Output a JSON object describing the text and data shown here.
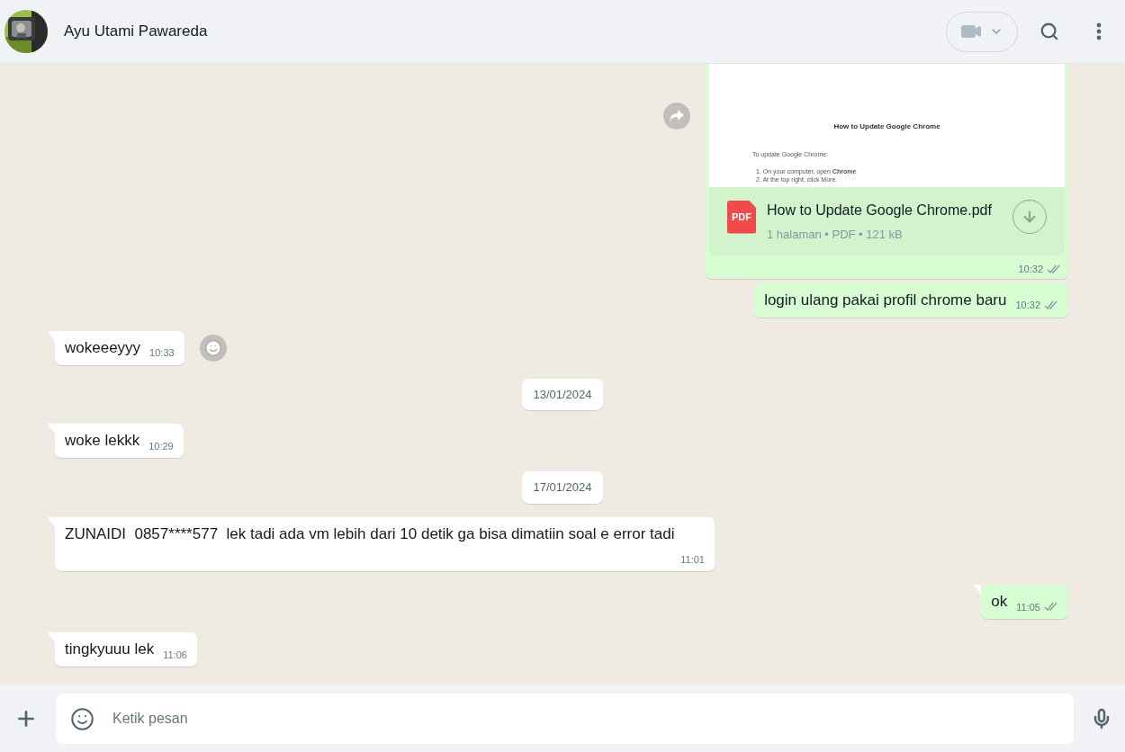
{
  "header": {
    "contact_name": "Ayu Utami Pawareda"
  },
  "messages": [
    {
      "kind": "document",
      "outgoing": true,
      "tail": false,
      "forward_button": true,
      "preview": {
        "title": "How to Update Google Chrome",
        "intro": "To update Google Chrome:",
        "steps": [
          {
            "number": "1.",
            "text": "On your computer, open **Chrome**"
          },
          {
            "number": "2.",
            "text": "At the top right, click More."
          }
        ]
      },
      "file_badge": "PDF",
      "file_name": "How to Update Google Chrome.pdf",
      "file_meta": "1 halaman • PDF • 121 kB",
      "time": "10:32",
      "delivered": true
    },
    {
      "kind": "text",
      "outgoing": true,
      "tail": false,
      "text": "login ulang pakai profil chrome baru",
      "time": "10:32",
      "delivered": true
    },
    {
      "kind": "text",
      "outgoing": false,
      "tail": true,
      "reaction_button": true,
      "text": "wokeeeyyy",
      "time": "10:33"
    },
    {
      "kind": "date",
      "text": "13/01/2024"
    },
    {
      "kind": "text",
      "outgoing": false,
      "tail": true,
      "text": "woke lekkk",
      "time": "10:29"
    },
    {
      "kind": "date",
      "text": "17/01/2024"
    },
    {
      "kind": "text",
      "outgoing": false,
      "tail": true,
      "text": "ZUNAIDI  0857****577  lek tadi ada vm lebih dari 10 detik ga bisa dimatiin soal e error tadi",
      "time": "11:01"
    },
    {
      "kind": "text",
      "outgoing": true,
      "tail": true,
      "text": "ok",
      "time": "11:05",
      "delivered": true
    },
    {
      "kind": "text",
      "outgoing": false,
      "tail": true,
      "text": "tingkyuuu lek",
      "time": "11:06"
    }
  ],
  "composer": {
    "placeholder": "Ketik pesan"
  }
}
